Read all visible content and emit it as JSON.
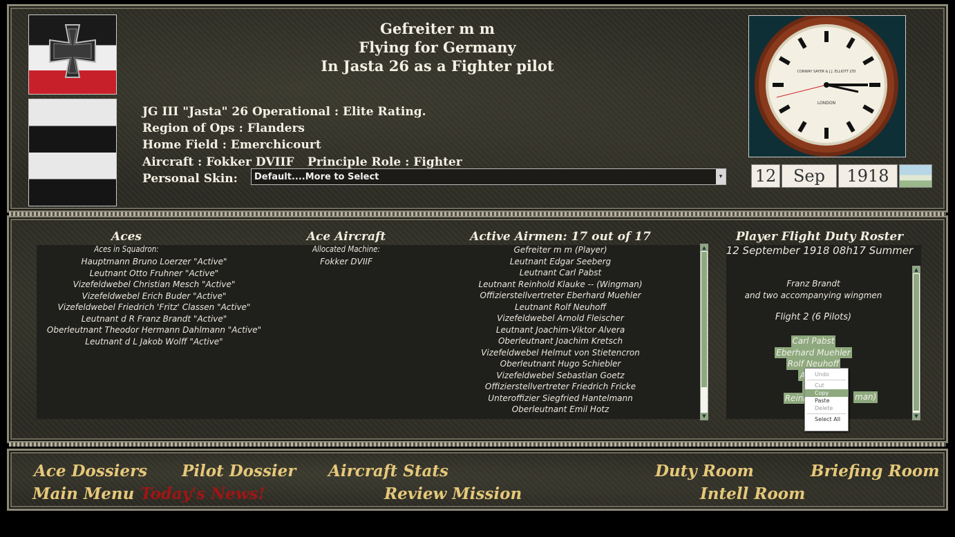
{
  "header": {
    "line1": "Gefreiter m m",
    "line2": "Flying for Germany",
    "line3": "In Jasta 26 as a Fighter pilot"
  },
  "info": {
    "unit": "JG III \"Jasta\" 26 Operational : Elite Rating.",
    "region": "Region of Ops : Flanders",
    "home_field": "Home Field : Emerchicourt",
    "aircraft": "Aircraft : Fokker DVIIF",
    "role": "Principle Role : Fighter",
    "skin_label": "Personal Skin:",
    "skin_value": "Default....More to Select"
  },
  "clock_text": {
    "maker": "CONWAY SAYER & J.J. ELLIOTT LTD",
    "city": "LONDON"
  },
  "date": {
    "day": "12",
    "month": "Sep",
    "year": "1918"
  },
  "aces": {
    "title": "Aces",
    "subtitle": "Aces in Squadron:",
    "items": [
      "Hauptmann Bruno Loerzer \"Active\"",
      "Leutnant Otto Fruhner \"Active\"",
      "Vizefeldwebel Christian Mesch \"Active\"",
      "Vizefeldwebel Erich Buder \"Active\"",
      "Vizefeldwebel Friedrich 'Fritz' Classen \"Active\"",
      "Leutnant d R Franz Brandt \"Active\"",
      "Oberleutnant Theodor Hermann Dahlmann \"Active\"",
      "Leutnant d L Jakob Wolff \"Active\""
    ]
  },
  "ace_aircraft": {
    "title": "Ace Aircraft",
    "subtitle": "Allocated Machine:",
    "items": [
      "Fokker DVIIF"
    ]
  },
  "airmen": {
    "title": "Active Airmen: 17 out of 17",
    "items": [
      "Gefreiter  m  m  (Player)",
      "Leutnant Edgar Seeberg",
      "Leutnant Carl Pabst",
      "Leutnant Reinhold Klauke -- (Wingman)",
      "Offizierstellvertreter Eberhard Muehler",
      "Leutnant Rolf Neuhoff",
      "Vizefeldwebel Arnold Fleischer",
      "Leutnant Joachim-Viktor Alvera",
      "Oberleutnant Joachim Kretsch",
      "Vizefeldwebel Helmut von Stietencron",
      "Oberleutnant Hugo Schiebler",
      "Vizefeldwebel Sebastian Goetz",
      "Offizierstellvertreter Friedrich Fricke",
      "Unteroffizier Siegfried Hantelmann",
      "Oberleutnant Emil Hotz"
    ]
  },
  "roster": {
    "title": "Player Flight Duty Roster",
    "datetime": "12 September 1918 08h17 Summer",
    "leader": "Franz Brandt",
    "leader_note": "and two accompanying wingmen",
    "flight": "Flight 2  (6 Pilots)",
    "pilots": [
      "Carl Pabst",
      "Eberhard Muehler",
      "Rolf Neuhoff",
      "Arnold",
      "m m",
      "Reinhold Klau"
    ],
    "pilot_tail": "man)"
  },
  "context_menu": {
    "undo": "Undo",
    "cut": "Cut",
    "copy": "Copy",
    "paste": "Paste",
    "delete": "Delete",
    "select_all": "Select All"
  },
  "nav": {
    "ace_dossiers": "Ace Dossiers",
    "pilot_dossier": "Pilot Dossier",
    "aircraft_stats": "Aircraft Stats",
    "duty_room": "Duty Room",
    "briefing_room": "Briefing Room",
    "main_menu": "Main Menu",
    "todays_news": "Today's News!",
    "review_mission": "Review Mission",
    "intell_room": "Intell Room"
  },
  "colors": {
    "nav_gold": "#e6c87a",
    "nav_red": "#a01515",
    "highlight_green": "#8ea97e"
  }
}
